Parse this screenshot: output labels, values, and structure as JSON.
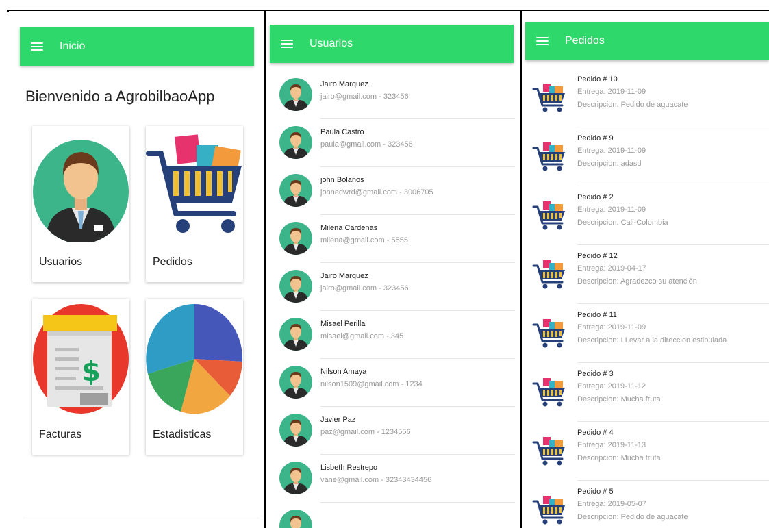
{
  "screens": {
    "inicio": {
      "title": "Inicio",
      "welcome": "Bienvenido a AgrobilbaoApp",
      "cards": [
        {
          "label": "Usuarios",
          "icon": "user-avatar-icon"
        },
        {
          "label": "Pedidos",
          "icon": "shopping-cart-icon"
        },
        {
          "label": "Facturas",
          "icon": "invoice-icon"
        },
        {
          "label": "Estadisticas",
          "icon": "pie-chart-icon"
        }
      ]
    },
    "usuarios": {
      "title": "Usuarios",
      "users": [
        {
          "name": "Jairo Marquez",
          "detail": "jairo@gmail.com - 323456"
        },
        {
          "name": "Paula Castro",
          "detail": "paula@gmail.com - 323456"
        },
        {
          "name": "john Bolanos",
          "detail": "johnedwrd@gmail.com - 3006705"
        },
        {
          "name": "Milena Cardenas",
          "detail": "milena@gmail.com - 5555"
        },
        {
          "name": "Jairo Marquez",
          "detail": "jairo@gmail.com - 323456"
        },
        {
          "name": "Misael Perilla",
          "detail": "misael@gmail.com - 345"
        },
        {
          "name": "Nilson Amaya",
          "detail": "nilson1509@gmail.com - 1234"
        },
        {
          "name": "Javier Paz",
          "detail": "paz@gmail.com - 1234556"
        },
        {
          "name": "Lisbeth Restrepo",
          "detail": "vane@gmail.com - 32343434456"
        }
      ]
    },
    "pedidos": {
      "title": "Pedidos",
      "orders": [
        {
          "title": "Pedido # 10",
          "entrega": "Entrega: 2019-11-09",
          "descripcion": "Descripcion: Pedido de aguacate"
        },
        {
          "title": "Pedido # 9",
          "entrega": "Entrega: 2019-11-09",
          "descripcion": "Descripcion: adasd"
        },
        {
          "title": "Pedido # 2",
          "entrega": "Entrega: 2019-11-09",
          "descripcion": "Descripcion: Cali-Colombia"
        },
        {
          "title": "Pedido # 12",
          "entrega": "Entrega: 2019-04-17",
          "descripcion": "Descripcion: Agradezco su atención"
        },
        {
          "title": "Pedido # 11",
          "entrega": "Entrega: 2019-11-09",
          "descripcion": "Descripcion: LLevar a la direccion estipulada"
        },
        {
          "title": "Pedido # 3",
          "entrega": "Entrega: 2019-11-12",
          "descripcion": "Descripcion: Mucha fruta"
        },
        {
          "title": "Pedido # 4",
          "entrega": "Entrega: 2019-11-13",
          "descripcion": "Descripcion: Mucha fruta"
        },
        {
          "title": "Pedido # 5",
          "entrega": "Entrega: 2019-05-07",
          "descripcion": "Descripcion: Pedido de aguacate"
        }
      ]
    }
  },
  "colors": {
    "appbar": "#2fd86a",
    "avatar_bg": "#3cb58a",
    "text_secondary": "#9a9a9a"
  }
}
